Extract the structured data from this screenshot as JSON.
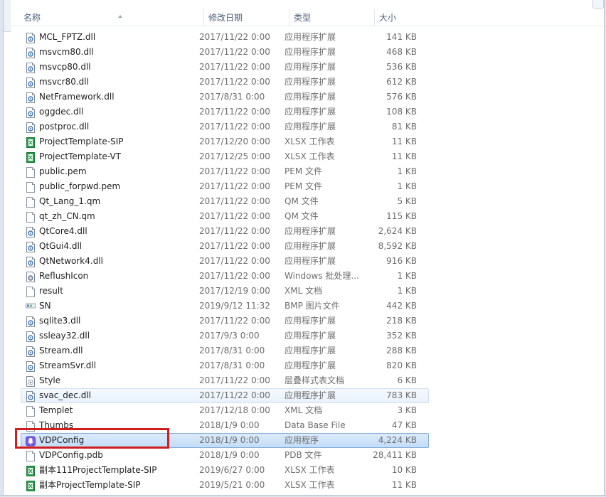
{
  "columns": {
    "name": "名称",
    "date": "修改日期",
    "type": "类型",
    "size": "大小"
  },
  "files": [
    {
      "name": "MCL_FPTZ.dll",
      "date": "2017/11/22 0:00",
      "type": "应用程序扩展",
      "size": "141 KB",
      "icon": "dll-icon",
      "state": "normal"
    },
    {
      "name": "msvcm80.dll",
      "date": "2017/11/22 0:00",
      "type": "应用程序扩展",
      "size": "468 KB",
      "icon": "dll-icon",
      "state": "normal"
    },
    {
      "name": "msvcp80.dll",
      "date": "2017/11/22 0:00",
      "type": "应用程序扩展",
      "size": "536 KB",
      "icon": "dll-icon",
      "state": "normal"
    },
    {
      "name": "msvcr80.dll",
      "date": "2017/11/22 0:00",
      "type": "应用程序扩展",
      "size": "612 KB",
      "icon": "dll-icon",
      "state": "normal"
    },
    {
      "name": "NetFramework.dll",
      "date": "2017/8/31 0:00",
      "type": "应用程序扩展",
      "size": "576 KB",
      "icon": "dll-icon",
      "state": "normal"
    },
    {
      "name": "oggdec.dll",
      "date": "2017/11/22 0:00",
      "type": "应用程序扩展",
      "size": "108 KB",
      "icon": "dll-icon",
      "state": "normal"
    },
    {
      "name": "postproc.dll",
      "date": "2017/11/22 0:00",
      "type": "应用程序扩展",
      "size": "81 KB",
      "icon": "dll-icon",
      "state": "normal"
    },
    {
      "name": "ProjectTemplate-SIP",
      "date": "2017/12/20 0:00",
      "type": "XLSX 工作表",
      "size": "11 KB",
      "icon": "xlsx-icon",
      "state": "normal"
    },
    {
      "name": "ProjectTemplate-VT",
      "date": "2017/12/25 0:00",
      "type": "XLSX 工作表",
      "size": "11 KB",
      "icon": "xlsx-icon",
      "state": "normal"
    },
    {
      "name": "public.pem",
      "date": "2017/11/22 0:00",
      "type": "PEM 文件",
      "size": "1 KB",
      "icon": "file-icon",
      "state": "normal"
    },
    {
      "name": "public_forpwd.pem",
      "date": "2017/11/22 0:00",
      "type": "PEM 文件",
      "size": "1 KB",
      "icon": "file-icon",
      "state": "normal"
    },
    {
      "name": "Qt_Lang_1.qm",
      "date": "2017/11/22 0:00",
      "type": "QM 文件",
      "size": "5 KB",
      "icon": "file-icon",
      "state": "normal"
    },
    {
      "name": "qt_zh_CN.qm",
      "date": "2017/11/22 0:00",
      "type": "QM 文件",
      "size": "115 KB",
      "icon": "file-icon",
      "state": "normal"
    },
    {
      "name": "QtCore4.dll",
      "date": "2017/11/22 0:00",
      "type": "应用程序扩展",
      "size": "2,624 KB",
      "icon": "dll-icon",
      "state": "normal"
    },
    {
      "name": "QtGui4.dll",
      "date": "2017/11/22 0:00",
      "type": "应用程序扩展",
      "size": "8,592 KB",
      "icon": "dll-icon",
      "state": "normal"
    },
    {
      "name": "QtNetwork4.dll",
      "date": "2017/11/22 0:00",
      "type": "应用程序扩展",
      "size": "916 KB",
      "icon": "dll-icon",
      "state": "normal"
    },
    {
      "name": "ReflushIcon",
      "date": "2017/11/22 0:00",
      "type": "Windows 批处理...",
      "size": "1 KB",
      "icon": "batch-icon",
      "state": "normal"
    },
    {
      "name": "result",
      "date": "2017/12/19 0:00",
      "type": "XML 文档",
      "size": "1 KB",
      "icon": "file-icon",
      "state": "normal"
    },
    {
      "name": "SN",
      "date": "2019/9/12 11:32",
      "type": "BMP 图片文件",
      "size": "442 KB",
      "icon": "bmp-icon",
      "state": "normal"
    },
    {
      "name": "sqlite3.dll",
      "date": "2017/11/22 0:00",
      "type": "应用程序扩展",
      "size": "218 KB",
      "icon": "dll-icon",
      "state": "normal"
    },
    {
      "name": "ssleay32.dll",
      "date": "2017/9/3 0:00",
      "type": "应用程序扩展",
      "size": "352 KB",
      "icon": "dll-icon",
      "state": "normal"
    },
    {
      "name": "Stream.dll",
      "date": "2017/8/31 0:00",
      "type": "应用程序扩展",
      "size": "288 KB",
      "icon": "dll-icon",
      "state": "normal"
    },
    {
      "name": "StreamSvr.dll",
      "date": "2017/8/31 0:00",
      "type": "应用程序扩展",
      "size": "820 KB",
      "icon": "dll-icon",
      "state": "normal"
    },
    {
      "name": "Style",
      "date": "2017/11/22 0:00",
      "type": "层叠样式表文档",
      "size": "6 KB",
      "icon": "css-icon",
      "state": "normal"
    },
    {
      "name": "svac_dec.dll",
      "date": "2017/11/22 0:00",
      "type": "应用程序扩展",
      "size": "783 KB",
      "icon": "dll-icon",
      "state": "hover"
    },
    {
      "name": "Templet",
      "date": "2017/12/18 0:00",
      "type": "XML 文档",
      "size": "3 KB",
      "icon": "file-icon",
      "state": "normal"
    },
    {
      "name": "Thumbs",
      "date": "2018/1/9 0:00",
      "type": "Data Base File",
      "size": "47 KB",
      "icon": "file-icon",
      "state": "normal"
    },
    {
      "name": "VDPConfig",
      "date": "2018/1/9 0:00",
      "type": "应用程序",
      "size": "4,224 KB",
      "icon": "app-icon",
      "state": "selected"
    },
    {
      "name": "VDPConfig.pdb",
      "date": "2018/1/9 0:00",
      "type": "PDB 文件",
      "size": "28,411 KB",
      "icon": "file-icon",
      "state": "normal"
    },
    {
      "name": "副本111ProjectTemplate-SIP",
      "date": "2019/6/27 0:00",
      "type": "XLSX 工作表",
      "size": "10 KB",
      "icon": "xlsx-icon",
      "state": "normal"
    },
    {
      "name": "副本ProjectTemplate-SIP",
      "date": "2019/5/21 0:00",
      "type": "XLSX 工作表",
      "size": "11 KB",
      "icon": "xlsx-icon",
      "state": "normal"
    }
  ]
}
